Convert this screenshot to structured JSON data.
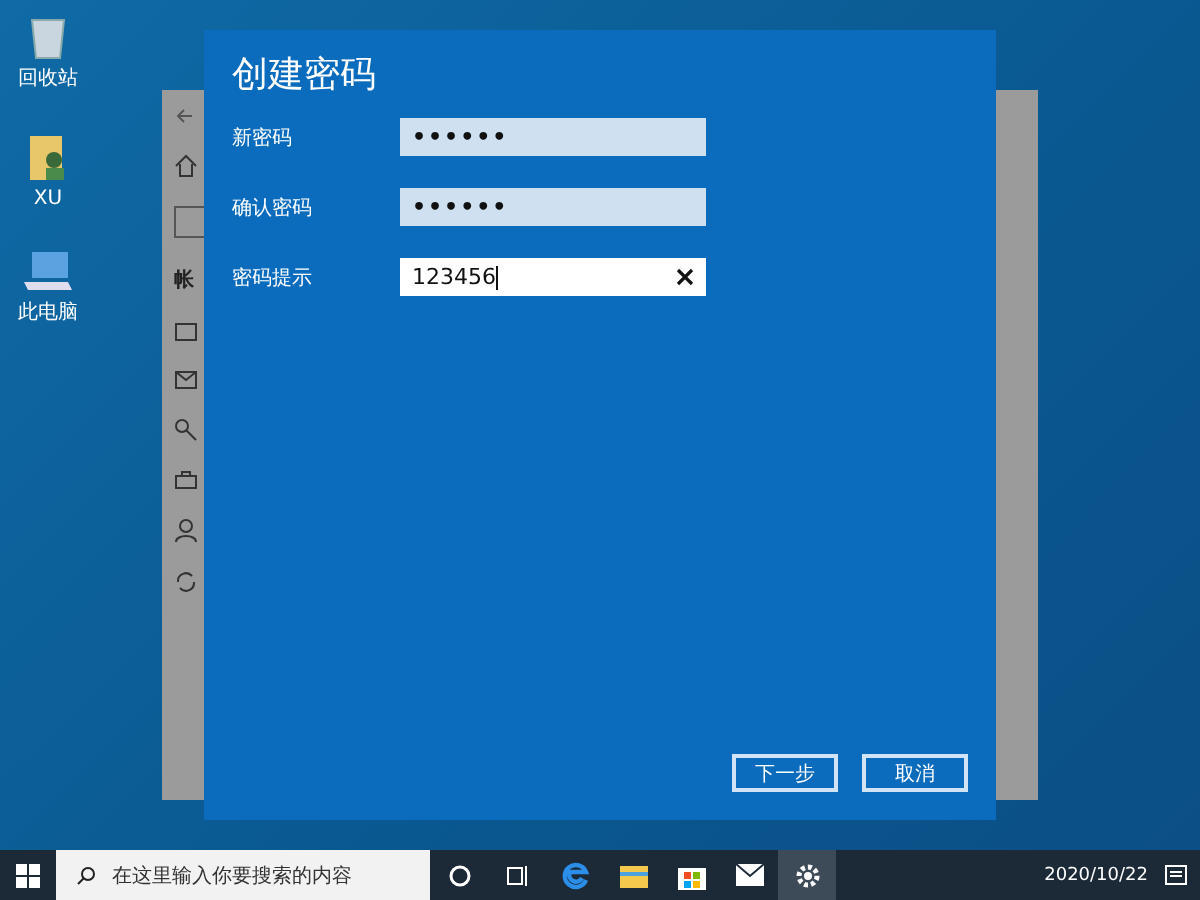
{
  "desktop_icons": [
    {
      "label": "回收站",
      "kind": "bin"
    },
    {
      "label": "XU",
      "kind": "user"
    },
    {
      "label": "此电脑",
      "kind": "pc"
    }
  ],
  "background_window": {
    "section_label": "帐"
  },
  "dialog": {
    "title": "创建密码",
    "fields": [
      {
        "label": "新密码",
        "value": "••••••",
        "kind": "password",
        "focused": false
      },
      {
        "label": "确认密码",
        "value": "••••••",
        "kind": "password",
        "focused": false
      },
      {
        "label": "密码提示",
        "value": "123456",
        "kind": "text",
        "focused": true
      }
    ],
    "buttons": [
      "下一步",
      "取消"
    ]
  },
  "taskbar": {
    "search_placeholder": "在这里输入你要搜索的内容",
    "date": "2020/10/22",
    "apps": [
      {
        "kind": "cortana",
        "selected": false
      },
      {
        "kind": "taskview",
        "selected": false
      },
      {
        "kind": "edge",
        "selected": false
      },
      {
        "kind": "folder",
        "selected": false
      },
      {
        "kind": "store",
        "selected": false
      },
      {
        "kind": "mail",
        "selected": false
      },
      {
        "kind": "settings",
        "selected": true
      }
    ]
  }
}
